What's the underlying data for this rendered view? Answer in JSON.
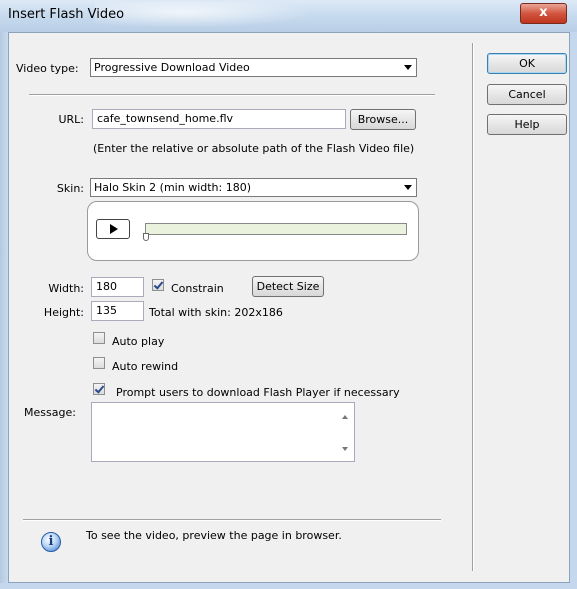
{
  "window": {
    "title": "Insert Flash Video",
    "close_glyph": "x"
  },
  "form": {
    "video_type_label": "Video type:",
    "video_type_value": "Progressive Download Video",
    "url_label": "URL:",
    "url_value": "cafe_townsend_home.flv",
    "browse_label": "Browse...",
    "url_hint": "(Enter the relative or absolute path of the Flash Video file)",
    "skin_label": "Skin:",
    "skin_value": "Halo Skin 2 (min width: 180)",
    "width_label": "Width:",
    "width_value": "180",
    "constrain_label": "Constrain",
    "constrain_checked": true,
    "detect_size_label": "Detect Size",
    "height_label": "Height:",
    "height_value": "135",
    "total_with_skin": "Total with skin: 202x186",
    "auto_play_label": "Auto play",
    "auto_play_checked": false,
    "auto_rewind_label": "Auto rewind",
    "auto_rewind_checked": false,
    "prompt_label": "Prompt users to download Flash Player if necessary",
    "prompt_checked": true,
    "message_label": "Message:",
    "message_value": ""
  },
  "buttons": {
    "ok": "OK",
    "cancel": "Cancel",
    "help": "Help"
  },
  "footer": {
    "info_text": "To see the video, preview the page in browser.",
    "info_glyph": "i"
  },
  "colors": {
    "seek_track": "#eaf1dc",
    "title_bar": "#c8dbef",
    "close_button": "#d2553f"
  }
}
